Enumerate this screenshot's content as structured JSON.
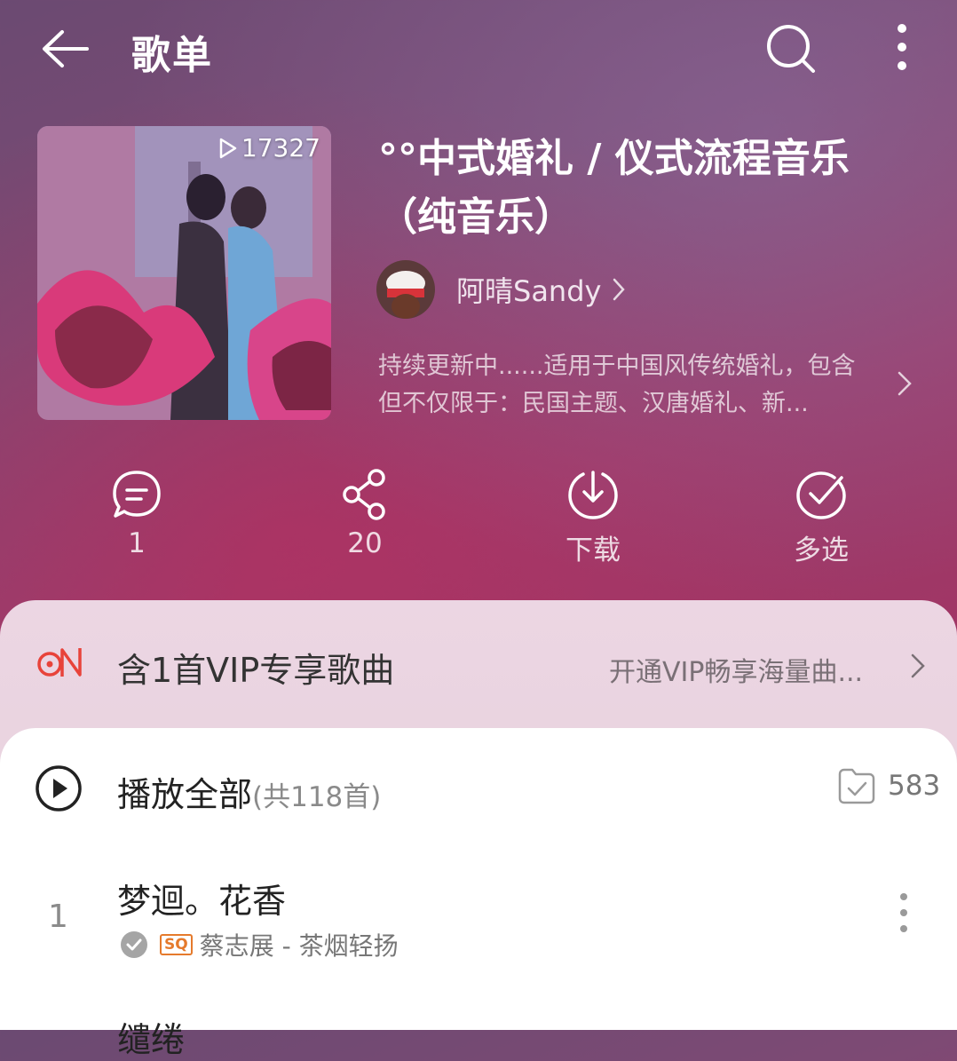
{
  "header": {
    "title": "歌单"
  },
  "cover": {
    "play_count": "17327"
  },
  "playlist": {
    "title": "°°中式婚礼 / 仪式流程音乐（纯音乐）",
    "creator": "阿晴Sandy",
    "description": "持续更新中......适用于中国风传统婚礼，包含但不仅限于：民国主题、汉唐婚礼、新..."
  },
  "actions": [
    {
      "label": "1",
      "icon": "comment-icon"
    },
    {
      "label": "20",
      "icon": "share-icon"
    },
    {
      "label": "下载",
      "icon": "download-icon"
    },
    {
      "label": "多选",
      "icon": "multi-select-icon"
    }
  ],
  "vip": {
    "text": "含1首VIP专享歌曲",
    "link": "开通VIP畅享海量曲..."
  },
  "play_all": {
    "label": "播放全部",
    "count": "(共118首)",
    "collect_count": "583"
  },
  "songs": [
    {
      "index": "1",
      "title": "梦迴。花香",
      "badge": "SQ",
      "artist": "蔡志展 - 茶烟轻扬"
    },
    {
      "title": "缱绻"
    }
  ],
  "colors": {
    "accent": "#e8433a",
    "sq_badge": "#e57a2c"
  }
}
